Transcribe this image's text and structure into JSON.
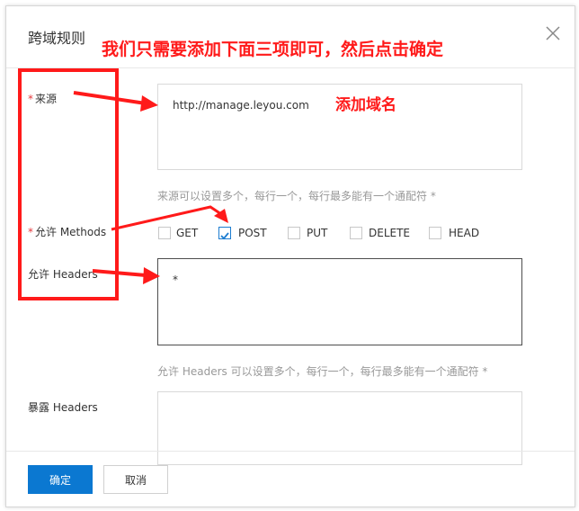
{
  "dialog": {
    "title": "跨域规则",
    "close_icon": "close-icon"
  },
  "form": {
    "origin": {
      "required_mark": "*",
      "label": "来源",
      "value": "http://manage.leyou.com",
      "hint": "来源可以设置多个，每行一个，每行最多能有一个通配符 *"
    },
    "methods": {
      "required_mark": "*",
      "label": "允许 Methods",
      "options": [
        {
          "label": "GET",
          "checked": false
        },
        {
          "label": "POST",
          "checked": true
        },
        {
          "label": "PUT",
          "checked": false
        },
        {
          "label": "DELETE",
          "checked": false
        },
        {
          "label": "HEAD",
          "checked": false
        }
      ]
    },
    "allow_headers": {
      "label": "允许 Headers",
      "value": "*",
      "hint": "允许 Headers 可以设置多个，每行一个，每行最多能有一个通配符 *"
    },
    "expose_headers": {
      "label": "暴露 Headers",
      "value": ""
    }
  },
  "buttons": {
    "confirm": "确定",
    "cancel": "取消"
  },
  "annotations": {
    "banner": "我们只需要添加下面三项即可，然后点击确定",
    "add_domain": "添加域名",
    "color": "#ff1a1a"
  }
}
